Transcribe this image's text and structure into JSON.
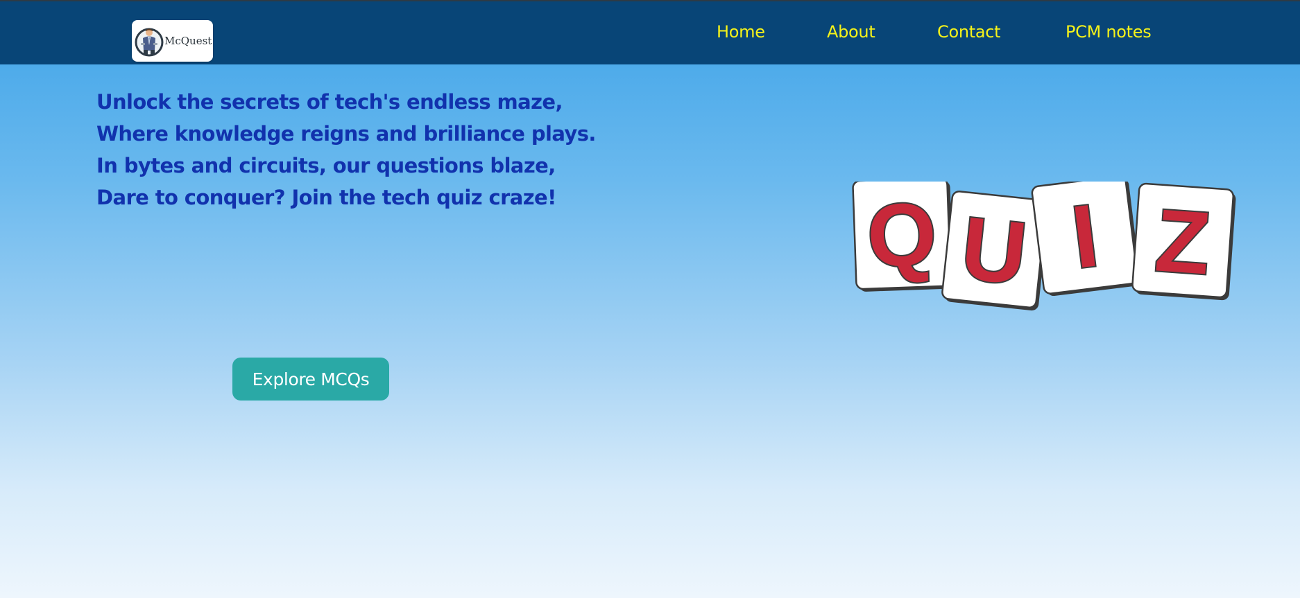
{
  "header": {
    "logo_text": "McQuest",
    "nav": [
      {
        "label": "Home"
      },
      {
        "label": "About"
      },
      {
        "label": "Contact"
      },
      {
        "label": "PCM notes"
      }
    ]
  },
  "hero": {
    "poem_lines": [
      "Unlock the secrets of tech's endless maze,",
      "Where knowledge reigns and brilliance plays.",
      "In bytes and circuits, our questions blaze,",
      "Dare to conquer? Join the tech quiz craze!"
    ],
    "cta_label": "Explore MCQs"
  },
  "illustration": {
    "tiles": [
      "Q",
      "U",
      "I",
      "Z"
    ]
  },
  "colors": {
    "header_bg": "#084577",
    "nav_text": "#f5f21a",
    "poem_text": "#1132ad",
    "cta_bg": "#2aa9a6",
    "tile_letter": "#c8283a"
  }
}
